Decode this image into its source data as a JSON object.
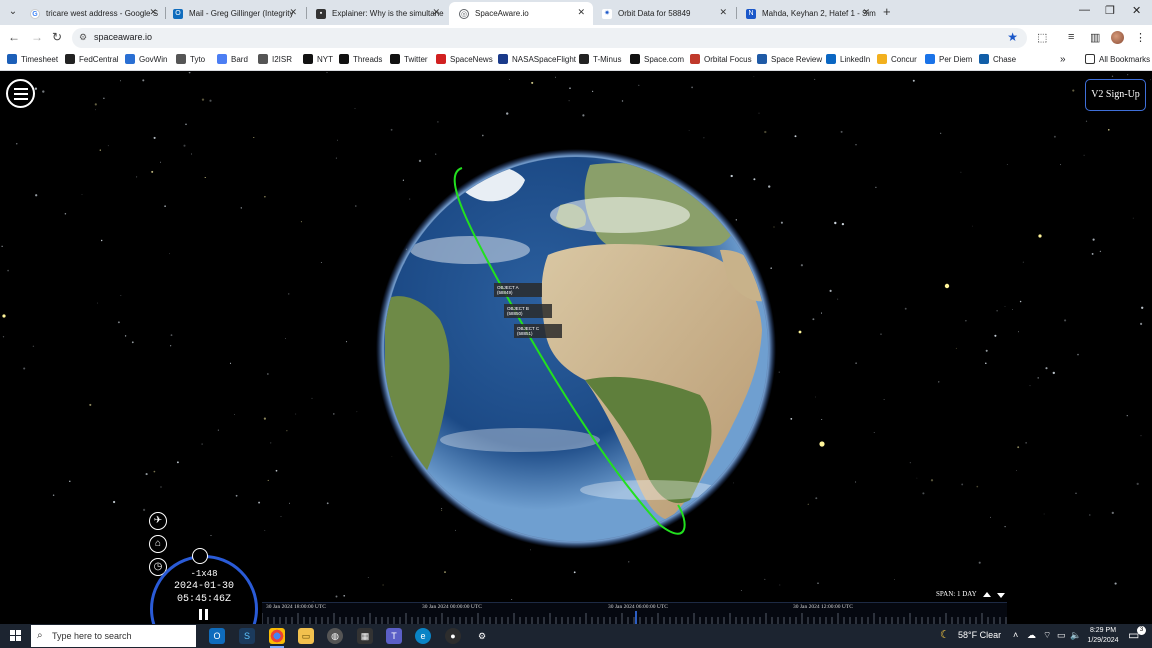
{
  "browser": {
    "tabs": [
      {
        "label": "tricare west address - Google S",
        "icon": "google-icon",
        "color": "#4285f4"
      },
      {
        "label": "Mail - Greg Gillinger (Integrity",
        "icon": "outlook-icon",
        "color": "#0f6cbd"
      },
      {
        "label": "Explainer: Why is the simultane",
        "icon": "news-icon",
        "color": "#333333"
      },
      {
        "label": "SpaceAware.io",
        "icon": "globe-icon",
        "color": "#5f6368"
      },
      {
        "label": "Orbit Data for 58849",
        "icon": "satellite-icon",
        "color": "#1a57c9"
      },
      {
        "label": "Mahda, Keyhan 2, Hatef 1 - Sim",
        "icon": "rocket-icon",
        "color": "#1a57c9"
      }
    ],
    "active_tab_index": 3,
    "url": "spaceaware.io",
    "bookmarks": [
      {
        "label": "Timesheet",
        "color": "#1c5fb8"
      },
      {
        "label": "FedCentral",
        "color": "#222222"
      },
      {
        "label": "GovWin",
        "color": "#2a6fd3"
      },
      {
        "label": "Tyto",
        "color": "#555555"
      },
      {
        "label": "Bard",
        "color": "#4c7ef3"
      },
      {
        "label": "I2ISR",
        "color": "#555555"
      },
      {
        "label": "NYT",
        "color": "#111111"
      },
      {
        "label": "Threads",
        "color": "#111111"
      },
      {
        "label": "Twitter",
        "color": "#111111"
      },
      {
        "label": "SpaceNews",
        "color": "#d12020"
      },
      {
        "label": "NASASpaceFlight",
        "color": "#1a3a8a"
      },
      {
        "label": "T-Minus",
        "color": "#222222"
      },
      {
        "label": "Space.com",
        "color": "#111111"
      },
      {
        "label": "Orbital Focus",
        "color": "#c0392b"
      },
      {
        "label": "Space Review",
        "color": "#1f5aa6"
      },
      {
        "label": "LinkedIn",
        "color": "#0a66c2"
      },
      {
        "label": "Concur",
        "color": "#f2b01e"
      },
      {
        "label": "Per Diem",
        "color": "#1a73e8"
      },
      {
        "label": "Chase",
        "color": "#115ea8"
      }
    ],
    "more_bookmarks": "»",
    "all_bookmarks": "All Bookmarks"
  },
  "app": {
    "signup_label": "V2 Sign-Up",
    "objects": [
      {
        "name": "OBJECT A",
        "id": "(58849)"
      },
      {
        "name": "OBJECT B",
        "id": "(58850)"
      },
      {
        "name": "OBJECT C",
        "id": "(58851)"
      }
    ],
    "orbit_color": "#22e01f",
    "speed": "-1x48",
    "date": "2024-01-30",
    "time": "05:45:46Z",
    "span_label": "SPAN: 1 DAY",
    "timeline_labels": [
      "30 Jan 2024 18:00:00 UTC",
      "30 Jan 2024 00:00:00 UTC",
      "30 Jan 2024 06:00:00 UTC",
      "30 Jan 2024 12:00:00 UTC"
    ]
  },
  "taskbar": {
    "search_placeholder": "Type here to search",
    "weather": "58°F  Clear",
    "time": "8:29 PM",
    "date": "1/29/2024",
    "notification_count": "3"
  }
}
